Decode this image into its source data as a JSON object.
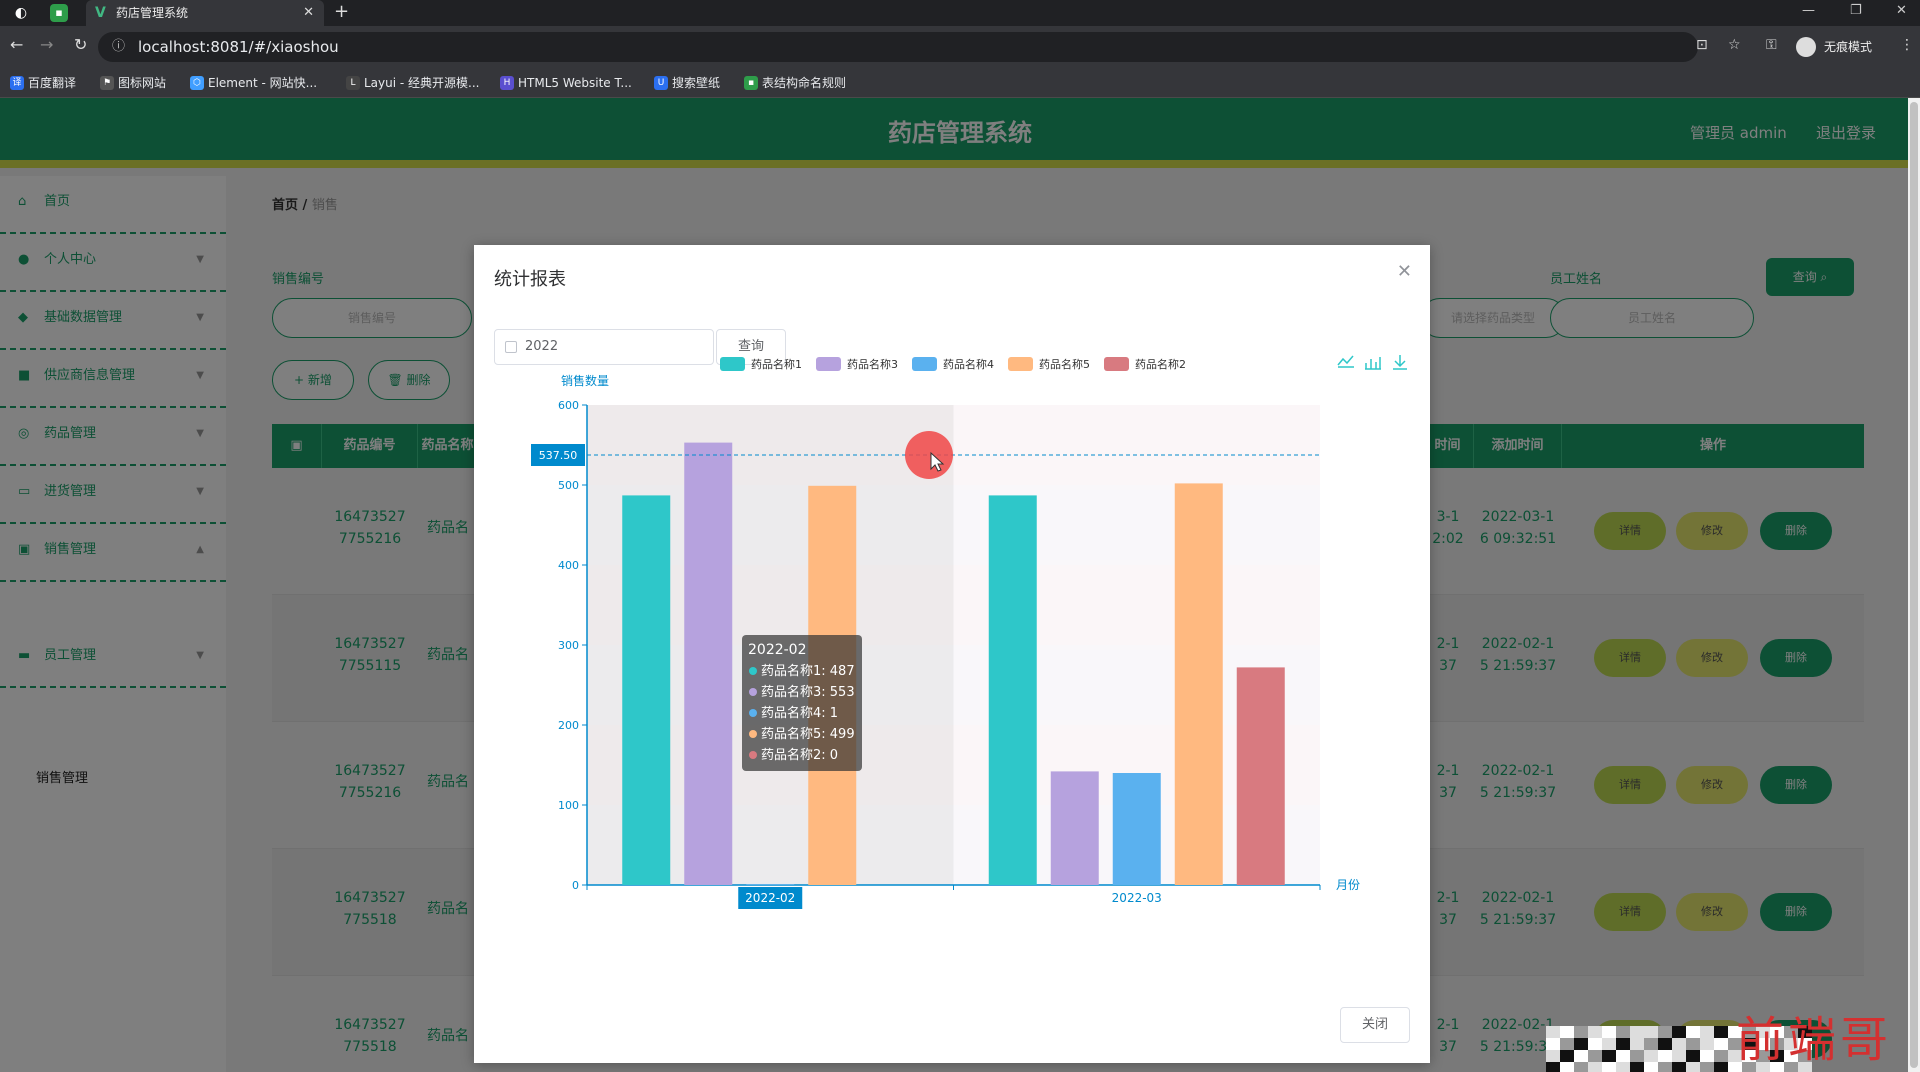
{
  "browser": {
    "tab_title": "药店管理系统",
    "url": "localhost:8081/#/xiaoshou",
    "incognito_label": "无痕模式",
    "bookmarks": [
      "百度翻译",
      "图标网站",
      "Element - 网站快...",
      "Layui - 经典开源模...",
      "HTML5 Website T...",
      "搜索壁纸",
      "表结构命名规则"
    ]
  },
  "header": {
    "title": "药店管理系统",
    "admin_label": "管理员 admin",
    "logout_label": "退出登录"
  },
  "sidebar": {
    "items": [
      {
        "label": "首页",
        "icon": "home-icon"
      },
      {
        "label": "个人中心",
        "icon": "user-icon"
      },
      {
        "label": "基础数据管理",
        "icon": "pin-icon"
      },
      {
        "label": "供应商信息管理",
        "icon": "box-icon"
      },
      {
        "label": "药品管理",
        "icon": "pill-icon"
      },
      {
        "label": "进货管理",
        "icon": "inbox-icon"
      },
      {
        "label": "销售管理",
        "icon": "cart-icon"
      },
      {
        "label": "员工管理",
        "icon": "people-icon"
      }
    ],
    "sub_item": "销售管理"
  },
  "breadcrumb": {
    "home": "首页",
    "separator": "/",
    "current": "销售"
  },
  "filters": {
    "sale_no_label": "销售编号",
    "sale_no_placeholder": "销售编号",
    "type_placeholder": "请选择药品类型",
    "employee_label": "员工姓名",
    "employee_placeholder": "员工姓名",
    "search_btn": "查询"
  },
  "actions": {
    "add": "新增",
    "delete": "删除"
  },
  "table": {
    "headers": [
      "药品编号",
      "药品名称",
      "时间",
      "添加时间",
      "操作"
    ],
    "rows": [
      {
        "code": "16473527\n7755216",
        "name": "药品名",
        "time": "2022-03-1\n6 09:32:51",
        "tp": "3-1\n2:02"
      },
      {
        "code": "16473527\n7755115",
        "name": "药品名",
        "time": "2022-02-1\n5 21:59:37",
        "tp": "2-1\n37"
      },
      {
        "code": "16473527\n7755216",
        "name": "药品名",
        "time": "2022-02-1\n5 21:59:37",
        "tp": "2-1\n37"
      },
      {
        "code": "16473527\n775518",
        "name": "药品名",
        "time": "2022-02-1\n5 21:59:37",
        "tp": "2-1\n37"
      },
      {
        "code": "16473527\n775518",
        "name": "药品名",
        "time": "2022-02-1\n5 21:59:37",
        "tp": "2-1\n37"
      }
    ],
    "row_buttons": {
      "detail": "详情",
      "edit": "修改",
      "delete": "删除"
    }
  },
  "modal": {
    "title": "统计报表",
    "year_value": "2022",
    "query_btn": "查询",
    "close_btn": "关闭"
  },
  "chart_data": {
    "type": "bar",
    "categories": [
      "2022-02",
      "2022-03"
    ],
    "series": [
      {
        "name": "药品名称1",
        "color": "#2ec7c9",
        "values": [
          487,
          487
        ]
      },
      {
        "name": "药品名称3",
        "color": "#b6a2de",
        "values": [
          553,
          142
        ]
      },
      {
        "name": "药品名称4",
        "color": "#5ab1ef",
        "values": [
          1,
          140
        ]
      },
      {
        "name": "药品名称5",
        "color": "#ffb980",
        "values": [
          499,
          502
        ]
      },
      {
        "name": "药品名称2",
        "color": "#d87a80",
        "values": [
          0,
          272
        ]
      }
    ],
    "ylabel": "销售数量",
    "xlabel": "月份",
    "ylim": [
      0,
      600
    ],
    "yticks": [
      "0",
      "100",
      "200",
      "300",
      "400",
      "500",
      "600"
    ],
    "axis_pointer_label": "537.50",
    "hover_category_label": "2022-02",
    "tooltip": {
      "title": "2022-02",
      "lines": [
        "药品名称1: 487",
        "药品名称3: 553",
        "药品名称4: 1",
        "药品名称5: 499",
        "药品名称2: 0"
      ]
    },
    "legend": "top-center"
  },
  "watermark_text": "前端哥"
}
